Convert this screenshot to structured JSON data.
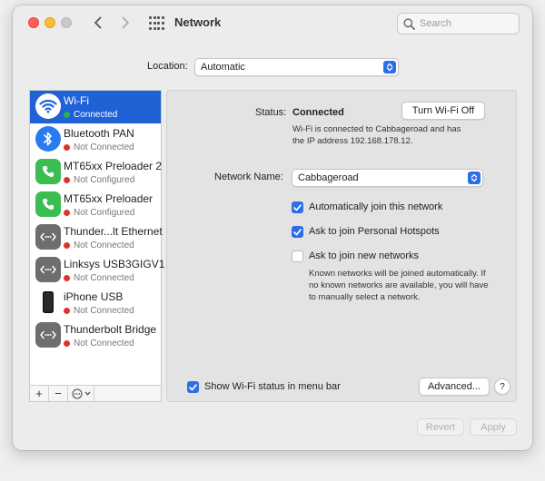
{
  "window": {
    "title": "Network"
  },
  "toolbar": {
    "search_placeholder": "Search"
  },
  "location": {
    "label": "Location:",
    "value": "Automatic"
  },
  "services": [
    {
      "name": "Wi-Fi",
      "status": "Connected",
      "status_color": "#2bb24c",
      "icon": "wifi-icon",
      "selected": true
    },
    {
      "name": "Bluetooth PAN",
      "status": "Not Connected",
      "status_color": "#e2312b",
      "icon": "bluetooth-icon"
    },
    {
      "name": "MT65xx Preloader 2",
      "status": "Not Configured",
      "status_color": "#e2312b",
      "icon": "phone-icon"
    },
    {
      "name": "MT65xx Preloader",
      "status": "Not Configured",
      "status_color": "#e2312b",
      "icon": "phone-icon"
    },
    {
      "name": "Thunder...lt Ethernet",
      "status": "Not Connected",
      "status_color": "#e2312b",
      "icon": "ethernet-icon"
    },
    {
      "name": "Linksys USB3GIGV1",
      "status": "Not Connected",
      "status_color": "#e2312b",
      "icon": "ethernet-icon"
    },
    {
      "name": "iPhone USB",
      "status": "Not Connected",
      "status_color": "#e2312b",
      "icon": "iphone-icon"
    },
    {
      "name": "Thunderbolt Bridge",
      "status": "Not Connected",
      "status_color": "#e2312b",
      "icon": "ethernet-icon"
    }
  ],
  "sidebar_actions": {
    "add": "+",
    "remove": "−"
  },
  "detail": {
    "status_label": "Status:",
    "status_value": "Connected",
    "turn_off_label": "Turn Wi-Fi Off",
    "status_desc_line1": "Wi-Fi is connected to Cabbageroad and has",
    "status_desc_line2": "the IP address 192.168.178.12.",
    "network_name_label": "Network Name:",
    "network_name_value": "Cabbageroad",
    "auto_join_label": "Automatically join this network",
    "auto_join_checked": true,
    "hotspots_label": "Ask to join Personal Hotspots",
    "hotspots_checked": true,
    "new_networks_label": "Ask to join new networks",
    "new_networks_checked": false,
    "new_networks_desc_line1": "Known networks will be joined automatically. If",
    "new_networks_desc_line2": "no known networks are available, you will have",
    "new_networks_desc_line3": "to manually select a network.",
    "show_status_label": "Show Wi-Fi status in menu bar",
    "show_status_checked": true,
    "advanced_label": "Advanced...",
    "help_label": "?"
  },
  "footer": {
    "revert_label": "Revert",
    "apply_label": "Apply"
  },
  "colors": {
    "accent": "#2c6ee9",
    "selection": "#1f62d6",
    "connected": "#2bb24c",
    "disconnected": "#e2312b"
  }
}
